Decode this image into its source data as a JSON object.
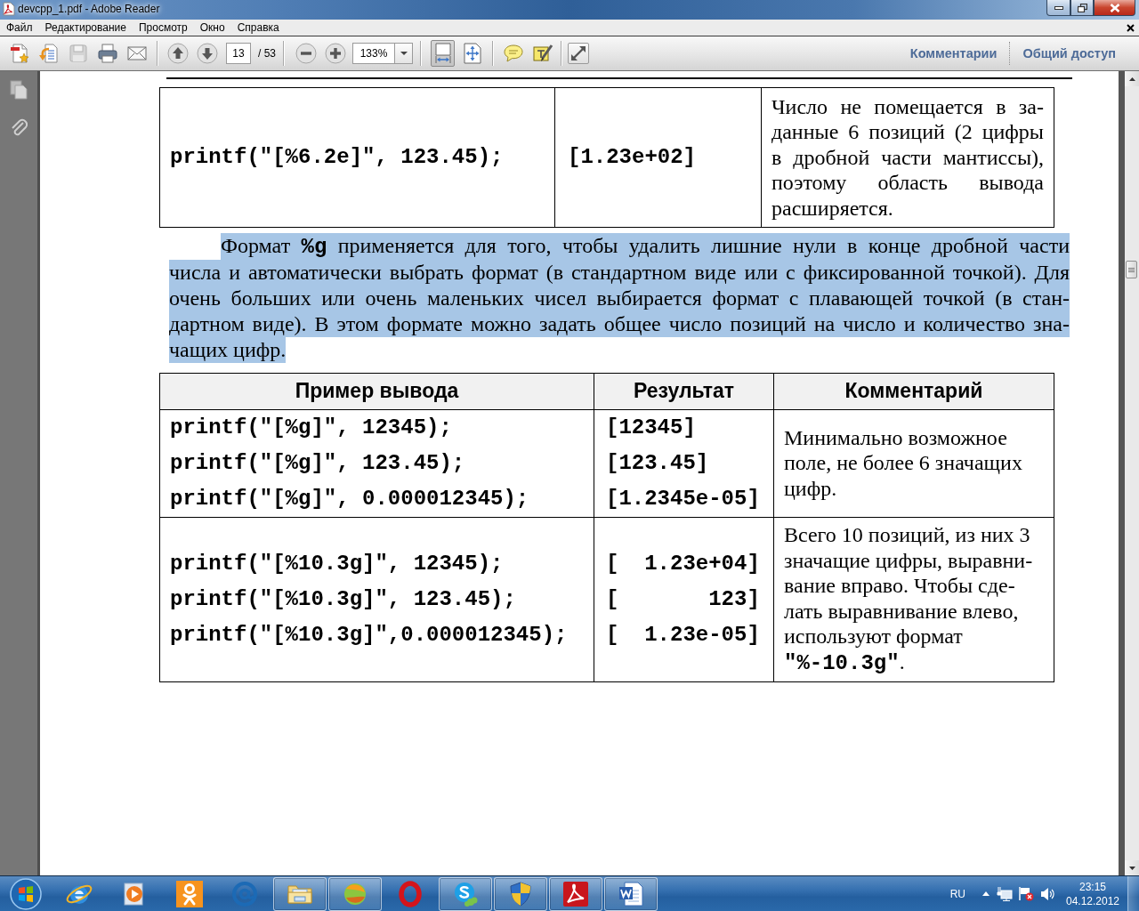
{
  "window": {
    "title": "devcpp_1.pdf - Adobe Reader"
  },
  "menu": [
    "Файл",
    "Редактирование",
    "Просмотр",
    "Окно",
    "Справка"
  ],
  "toolbar": {
    "save_button": {
      "disabled": true
    },
    "page_field": {
      "value": "13"
    },
    "page_count": "/ 53",
    "zoom_field": {
      "value": "133%"
    },
    "view_buttons": [
      {
        "kind": "fit-width",
        "selected": true
      },
      {
        "kind": "fit-page",
        "selected": false
      }
    ],
    "panel_links": [
      "Комментарии",
      "Общий доступ"
    ]
  },
  "document": {
    "table_1": {
      "rows": [
        {
          "code": "printf(\"[%6.2e]\", 123.45);",
          "result": "[1.23e+02]",
          "comment_lines": [
            "Число не помещается в за-",
            "данные 6 позиций (2 цифры",
            "в дробной части мантиссы),",
            "поэтому область вывода",
            "расширяется."
          ]
        }
      ]
    },
    "paragraph": {
      "selected": true,
      "lines": [
        "Формат **%g** применяется для того, чтобы удалить лишние нули в конце дробной части",
        "числа и автоматически выбрать формат (в стандартном виде или с фиксированной точкой). Для",
        "очень больших или очень маленьких чисел выбирается формат с плавающей точкой (в стан-",
        "дартном виде). В этом формате можно задать общее число позиций на число и количество зна-",
        "чащих цифр."
      ]
    },
    "table_2": {
      "columns": [
        "Пример вывода",
        "Результат",
        "Комментарий"
      ],
      "rows": [
        {
          "examples": [
            {
              "code": "printf(\"[%g]\", 12345);",
              "result": "[12345]"
            },
            {
              "code": "printf(\"[%g]\", 123.45);",
              "result": "[123.45]"
            },
            {
              "code": "printf(\"[%g]\", 0.000012345);",
              "result": "[1.2345e-05]"
            }
          ],
          "comment_lines": [
            "Минимально возможное",
            "поле, не более 6 значащих",
            "цифр."
          ]
        },
        {
          "examples": [
            {
              "code": "printf(\"[%10.3g]\", 12345);",
              "result": "[  1.23e+04]"
            },
            {
              "code": "printf(\"[%10.3g]\", 123.45);",
              "result": "[       123]"
            },
            {
              "code": "printf(\"[%10.3g]\",0.000012345);",
              "result": "[  1.23e-05]"
            }
          ],
          "comment_lines": [
            "Всего 10 позиций, из них 3",
            "значащие цифры, выравни-",
            "вание вправо. Чтобы сде-",
            "лать выравнивание влево,",
            "используют формат",
            "**\"%-10.3g\"**."
          ]
        }
      ]
    }
  },
  "taskbar": {
    "apps": [
      {
        "kind": "globe",
        "open": false
      },
      {
        "kind": "play",
        "open": false
      },
      {
        "kind": "person",
        "open": false
      },
      {
        "kind": "at",
        "open": false
      },
      {
        "kind": "folder",
        "open": true
      },
      {
        "kind": "ball",
        "open": true
      },
      {
        "kind": "ring",
        "open": false
      },
      {
        "kind": "cloud",
        "open": true
      },
      {
        "kind": "shield",
        "open": true
      },
      {
        "kind": "swoosh",
        "open": true
      },
      {
        "kind": "document",
        "open": true
      }
    ],
    "language": "RU",
    "time": "23:15",
    "date": "04.12.2012"
  }
}
